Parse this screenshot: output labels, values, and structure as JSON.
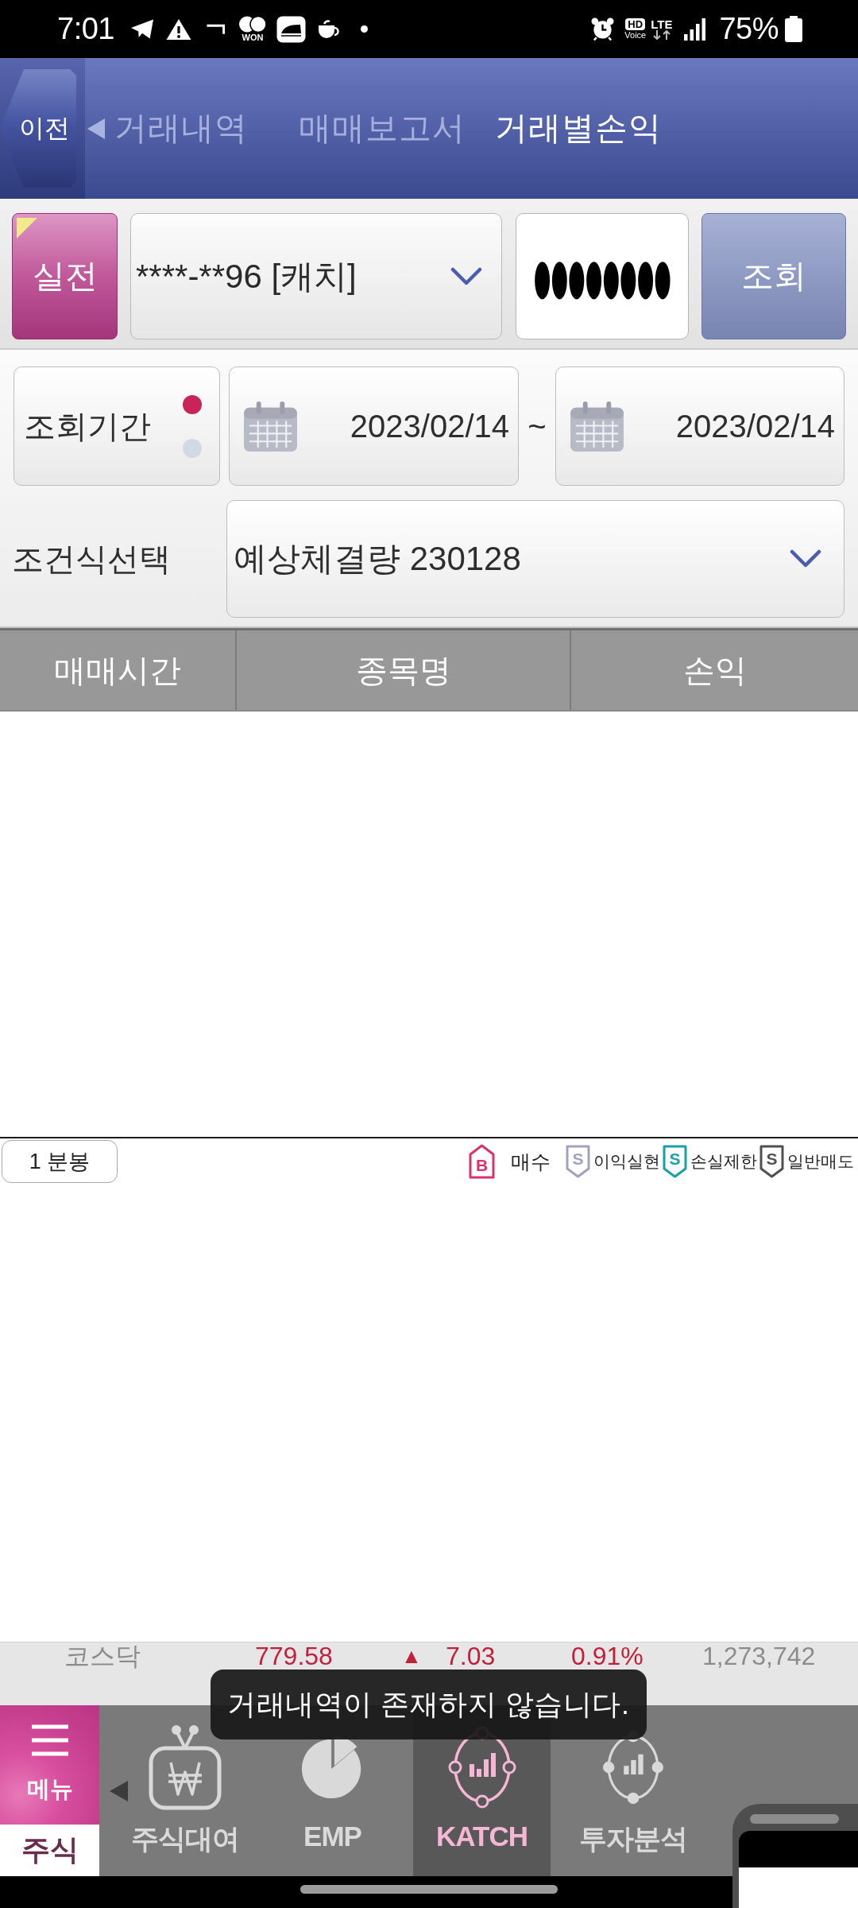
{
  "status_bar": {
    "time": "7:01",
    "won_label": "WON",
    "hd_label": "HD",
    "voice_label": "Voice",
    "network_label": "LTE",
    "battery": "75%"
  },
  "header": {
    "back_button": "이전",
    "tabs": [
      {
        "label": "거래내역",
        "selected": false
      },
      {
        "label": "매매보고서",
        "selected": false
      },
      {
        "label": "거래별손익",
        "selected": true
      }
    ]
  },
  "account_bar": {
    "mode_button": "실전",
    "account": "****-**96 [캐치]",
    "password": {
      "value": "●●●●●●●●"
    },
    "search_button": "조회"
  },
  "period": {
    "label": "조회기간",
    "options": [
      {
        "selected": true
      },
      {
        "selected": false
      }
    ],
    "start_date": "2023/02/14",
    "separator": "~",
    "end_date": "2023/02/14"
  },
  "condition": {
    "label": "조건식선택",
    "value": "예상체결량 230128"
  },
  "table": {
    "columns": [
      "매매시간",
      "종목명",
      "손익"
    ]
  },
  "chart_toolbar": {
    "interval_button": "1 분봉",
    "legend": [
      {
        "kind": "buy",
        "letter": "B",
        "label": "매수",
        "color": "#d8336b"
      },
      {
        "kind": "sell",
        "letter": "S",
        "label": "이익실현",
        "color": "#a2a2bf"
      },
      {
        "kind": "sell",
        "letter": "S",
        "label": "손실제한",
        "color": "#16a2a6"
      },
      {
        "kind": "sell",
        "letter": "S",
        "label": "일반매도",
        "color": "#505050"
      }
    ]
  },
  "ticker": {
    "index_name": "코스닥",
    "value": "779.58",
    "arrow": "▲",
    "change": "7.03",
    "percent": "0.91%",
    "volume": "1,273,742"
  },
  "bottom_nav": {
    "menu_label": "메뉴",
    "section_label": "주식",
    "items": [
      {
        "label": "주식대여",
        "kind": "won-tv",
        "selected": false
      },
      {
        "label": "EMP",
        "kind": "pie",
        "selected": false
      },
      {
        "label": "KATCH",
        "kind": "katch",
        "selected": true
      },
      {
        "label": "투자분석",
        "kind": "analysis",
        "selected": false
      }
    ]
  },
  "toast": {
    "message": "거래내역이 존재하지 않습니다."
  }
}
